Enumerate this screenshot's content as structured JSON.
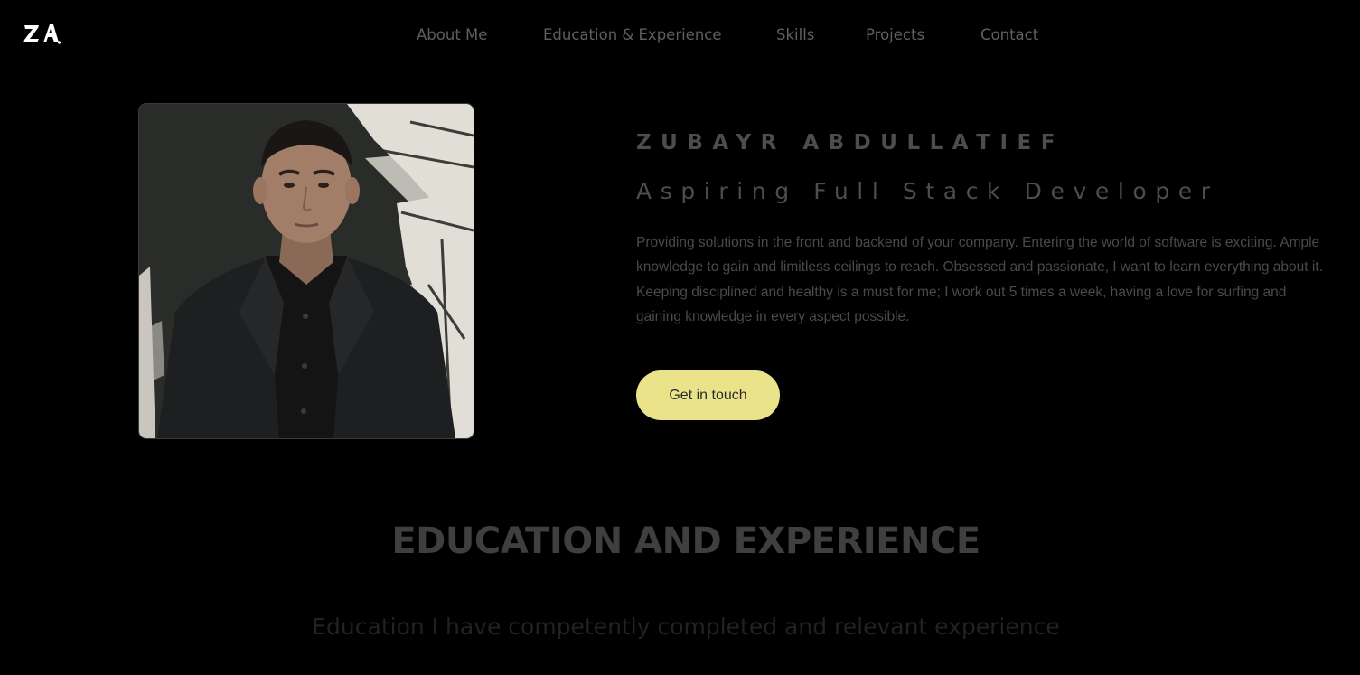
{
  "header": {
    "logo_text": "ZA.",
    "nav": [
      {
        "label": "About Me"
      },
      {
        "label": "Education & Experience"
      },
      {
        "label": "Skills"
      },
      {
        "label": "Projects"
      },
      {
        "label": "Contact"
      }
    ]
  },
  "hero": {
    "name": "ZUBAYR ABDULLATIEF",
    "role": "Aspiring Full Stack Developer",
    "description": "Providing solutions in the front and backend of your company. Entering the world of software is exciting. Ample knowledge to gain and limitless ceilings to reach. Obsessed and passionate, I want to learn everything about it. Keeping disciplined and healthy is a must for me; I work out 5 times a week, having a love for surfing and gaining knowledge in every aspect possible.",
    "cta_label": "Get in touch",
    "cta_color": "#ebe38a"
  },
  "section": {
    "title": "EDUCATION AND EXPERIENCE",
    "subtitle": "Education I have competently completed and relevant experience"
  },
  "colors": {
    "background": "#000000",
    "nav_text": "#5f5f5f",
    "accent": "#ebe38a"
  }
}
